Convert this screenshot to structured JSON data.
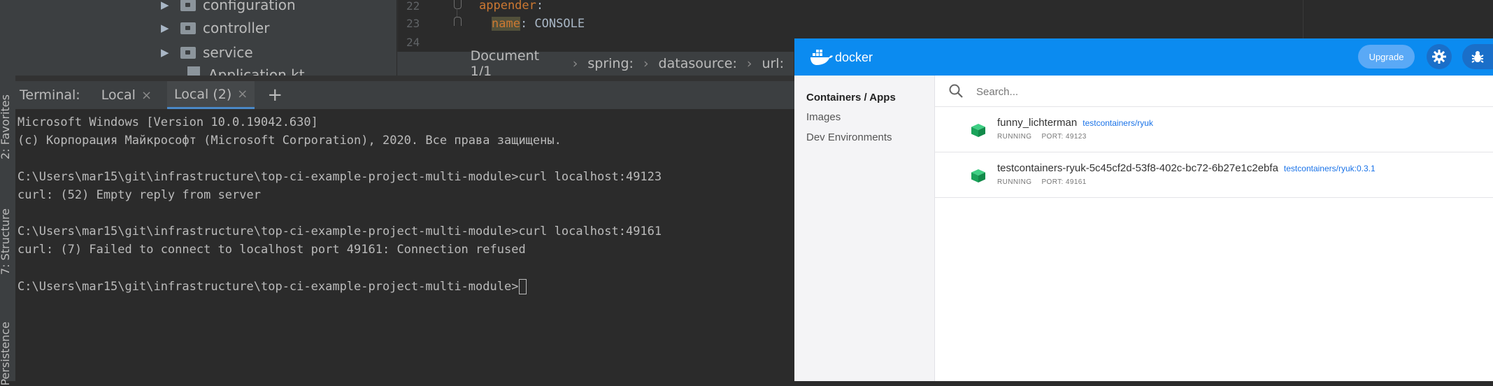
{
  "ide": {
    "left_tools": [
      "2: Favorites",
      "7: Structure",
      "Persistence"
    ],
    "project_tree": {
      "items": [
        "configuration",
        "controller",
        "service",
        "Application.kt"
      ]
    },
    "editor": {
      "line_numbers": [
        "22",
        "23",
        "24"
      ],
      "line22_key": "appender",
      "line22_colon": ":",
      "line23_key": "name",
      "line23_value": ": CONSOLE"
    },
    "breadcrumb": {
      "items": [
        "Document 1/1",
        "spring:",
        "datasource:",
        "url:"
      ]
    },
    "terminal": {
      "label": "Terminal:",
      "tabs": [
        "Local",
        "Local (2)"
      ],
      "new_tab": "+",
      "close": "×",
      "lines": [
        "Microsoft Windows [Version 10.0.19042.630]",
        "(c) Корпорация Майкрософт (Microsoft Corporation), 2020. Все права защищены.",
        "",
        "C:\\Users\\mar15\\git\\infrastructure\\top-ci-example-project-multi-module>curl localhost:49123",
        "curl: (52) Empty reply from server",
        "",
        "C:\\Users\\mar15\\git\\infrastructure\\top-ci-example-project-multi-module>curl localhost:49161",
        "curl: (7) Failed to connect to localhost port 49161: Connection refused",
        "",
        "C:\\Users\\mar15\\git\\infrastructure\\top-ci-example-project-multi-module>"
      ]
    }
  },
  "docker": {
    "brand": "docker",
    "upgrade_label": "Upgrade",
    "nav": [
      "Containers / Apps",
      "Images",
      "Dev Environments"
    ],
    "search_placeholder": "Search...",
    "containers": [
      {
        "name": "funny_lichterman",
        "image": "testcontainers/ryuk",
        "status": "RUNNING",
        "port": "PORT: 49123"
      },
      {
        "name": "testcontainers-ryuk-5c45cf2d-53f8-402c-bc72-6b27e1c2ebfa",
        "image": "testcontainers/ryuk:0.3.1",
        "status": "RUNNING",
        "port": "PORT: 49161"
      }
    ]
  },
  "colors": {
    "docker_blue": "#0b8bf0",
    "container_green": "#1aa35a",
    "link_blue": "#1a73e8"
  }
}
